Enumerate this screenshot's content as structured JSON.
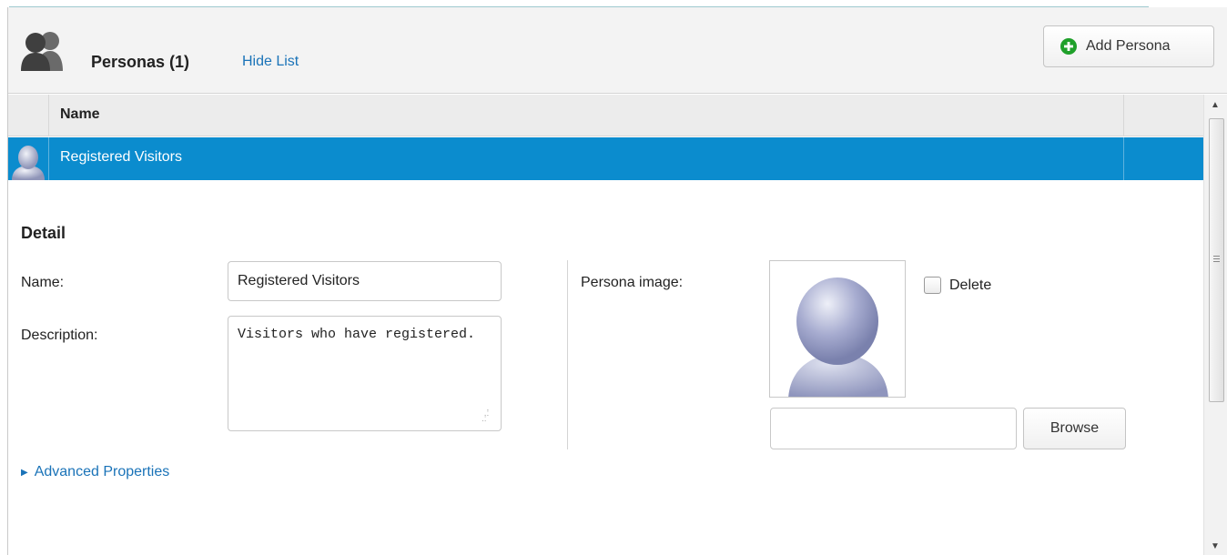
{
  "header": {
    "title": "Personas (1)",
    "hide_list": "Hide List",
    "add_button": "Add Persona"
  },
  "grid": {
    "column_name": "Name",
    "rows": [
      {
        "name": "Registered Visitors",
        "selected": true
      }
    ]
  },
  "detail": {
    "title": "Detail",
    "name_label": "Name:",
    "name_value": "Registered Visitors",
    "description_label": "Description:",
    "description_value": "Visitors who have registered.",
    "image_label": "Persona image:",
    "delete_label": "Delete",
    "browse_label": "Browse",
    "file_value": ""
  },
  "advanced": {
    "label": "Advanced Properties"
  },
  "colors": {
    "selection": "#0b8cce",
    "link": "#1a73b8",
    "add_icon": "#1fa02a"
  }
}
